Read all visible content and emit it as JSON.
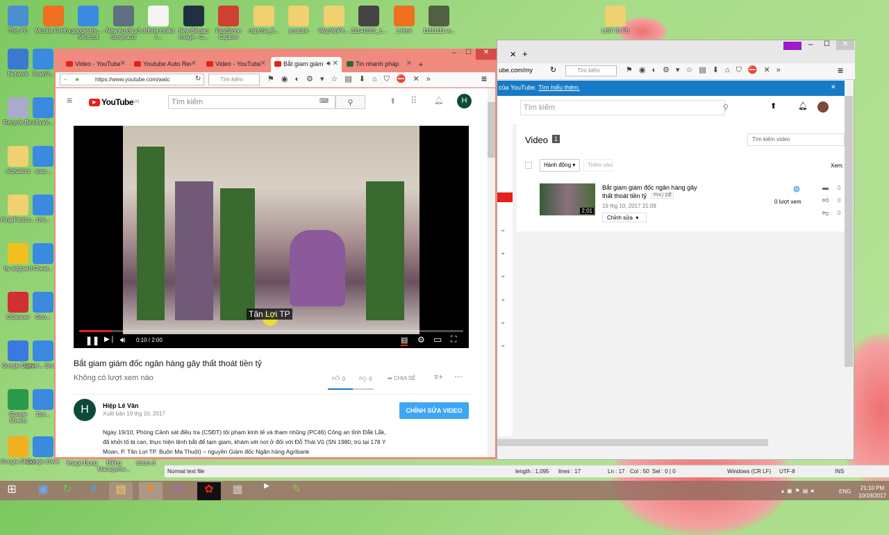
{
  "desktop": {
    "top_icons": [
      "This PC",
      "Mozilla Firefox",
      "googledriv... - Shortcut",
      "New AutoIt v3 Script.au3",
      "drfone toolkit f...",
      "New Bitmap Image - C...",
      "FastStone Capture",
      "captcha_fi...",
      "youtube",
      "WapVipPh...",
      "22141022_1...",
      "1.html",
      "11111111.w..."
    ],
    "far_icon": "LIST ID FB",
    "left_icons": [
      "Network",
      "Recycle Bin",
      "Activators",
      "NinjaFastLo...",
      "by adguard",
      "CCleaner",
      "Google Docs",
      "Google Sheets",
      "Google Slides"
    ],
    "left_icons_col2": [
      "TeamV...",
      "UltraV...",
      "sour...",
      "Uni...",
      "Cheat...",
      "Goo...",
      "devel... Shor...",
      "Dot...",
      "Google Drive"
    ],
    "bottom_icons": [
      "Image Dung",
      "Billing Manageme...",
      "doom-3"
    ]
  },
  "front": {
    "tabs": [
      {
        "label": "Video - YouTube"
      },
      {
        "label": "Youtube Auto Reup"
      },
      {
        "label": "Video - YouTube"
      },
      {
        "label": "Bắt giam giám"
      },
      {
        "label": "Tin nhanh pháp"
      }
    ],
    "url": "https://www.youtube.com/watc",
    "search_placeholder": "Tìm kiếm",
    "yt": {
      "logo": "YouTube",
      "region": "VN",
      "search_placeholder": "Tìm kiếm",
      "avatar": "H",
      "caption": "Tân Lợi TP",
      "time": "0:10 / 2:00",
      "progress": 0.083,
      "title": "Bắt giam giám đốc ngân hàng gây thất thoát tiền tỷ",
      "views": "Không có lượt xem nào",
      "likes": "0",
      "dislikes": "0",
      "share": "CHIA SẺ",
      "channel": "Hiệp Lê Văn",
      "published": "Xuất bản 19 thg 10, 2017",
      "edit_button": "CHỈNH SỬA VIDEO",
      "description": "Ngày 19/10, Phòng Cảnh sát điều tra (CSĐT) tội phạm kinh tế và tham nhũng (PC46) Công an tỉnh Đắk Lắk, đã khởi tố bị can, thực hiện lệnh bắt để tạm giam, khám xét nơi ở đối với Đỗ Thái Vũ (SN 1980, trú tại 178 Y Moan, P. Tân Lợi TP. Buôn Ma Thuột) – nguyên Giám đốc Ngân hàng Agribank"
    }
  },
  "back": {
    "url": "ube.com/my",
    "search_placeholder": "Tìm kiếm",
    "banner": "của YouTube.",
    "banner_link": "Tìm hiểu thêm.",
    "yt_search": "Tìm kiếm",
    "heading": "Video",
    "count": "1",
    "search_video": "Tìm kiếm video",
    "actions": "Hành động",
    "add_to": "Thêm vào",
    "view_label": "Xem:",
    "video": {
      "title": "Bắt giam giám đốc ngân hàng gây thất thoát tiền tỷ",
      "badge": "PHỤ ĐỀ",
      "date": "19 thg 10, 2017 21:09",
      "duration": "2:01",
      "edit": "Chỉnh sửa",
      "views": "0 lượt xem",
      "comments": "0",
      "likes": "0",
      "dislikes": "0"
    }
  },
  "statusbar": {
    "type": "Normal text file",
    "length": "length : 1,095",
    "lines": "lines : 17",
    "pos": "Ln : 17",
    "col": "Col : 50",
    "sel": "Sel : 0 | 0",
    "eol": "Windows (CR LF)",
    "enc": "UTF-8",
    "mode": "INS"
  },
  "taskbar": {
    "lang": "ENG",
    "time": "21:10 PM",
    "date": "10/19/2017"
  }
}
